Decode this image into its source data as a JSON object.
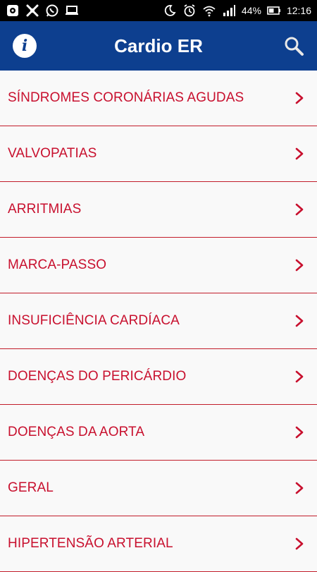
{
  "status_bar": {
    "left_icons": [
      "settings-badge-icon",
      "bug-icon",
      "whatsapp-icon",
      "laptop-icon"
    ],
    "right_icons": [
      "do-not-disturb-icon",
      "alarm-icon",
      "wifi-icon",
      "signal-icon",
      "battery-icon"
    ],
    "battery_percent": "44%",
    "time": "12:16"
  },
  "header": {
    "title": "Cardio ER",
    "info_icon": "info-icon",
    "search_icon": "search-icon",
    "background_color": "#0d3f8f"
  },
  "menu": {
    "accent_color": "#c8102e",
    "items": [
      {
        "label": "SÍNDROMES CORONÁRIAS AGUDAS"
      },
      {
        "label": "VALVOPATIAS"
      },
      {
        "label": "ARRITMIAS"
      },
      {
        "label": "MARCA-PASSO"
      },
      {
        "label": "INSUFICIÊNCIA CARDÍACA"
      },
      {
        "label": "DOENÇAS DO PERICÁRDIO"
      },
      {
        "label": "DOENÇAS DA AORTA"
      },
      {
        "label": "GERAL"
      },
      {
        "label": "HIPERTENSÃO ARTERIAL"
      }
    ]
  }
}
